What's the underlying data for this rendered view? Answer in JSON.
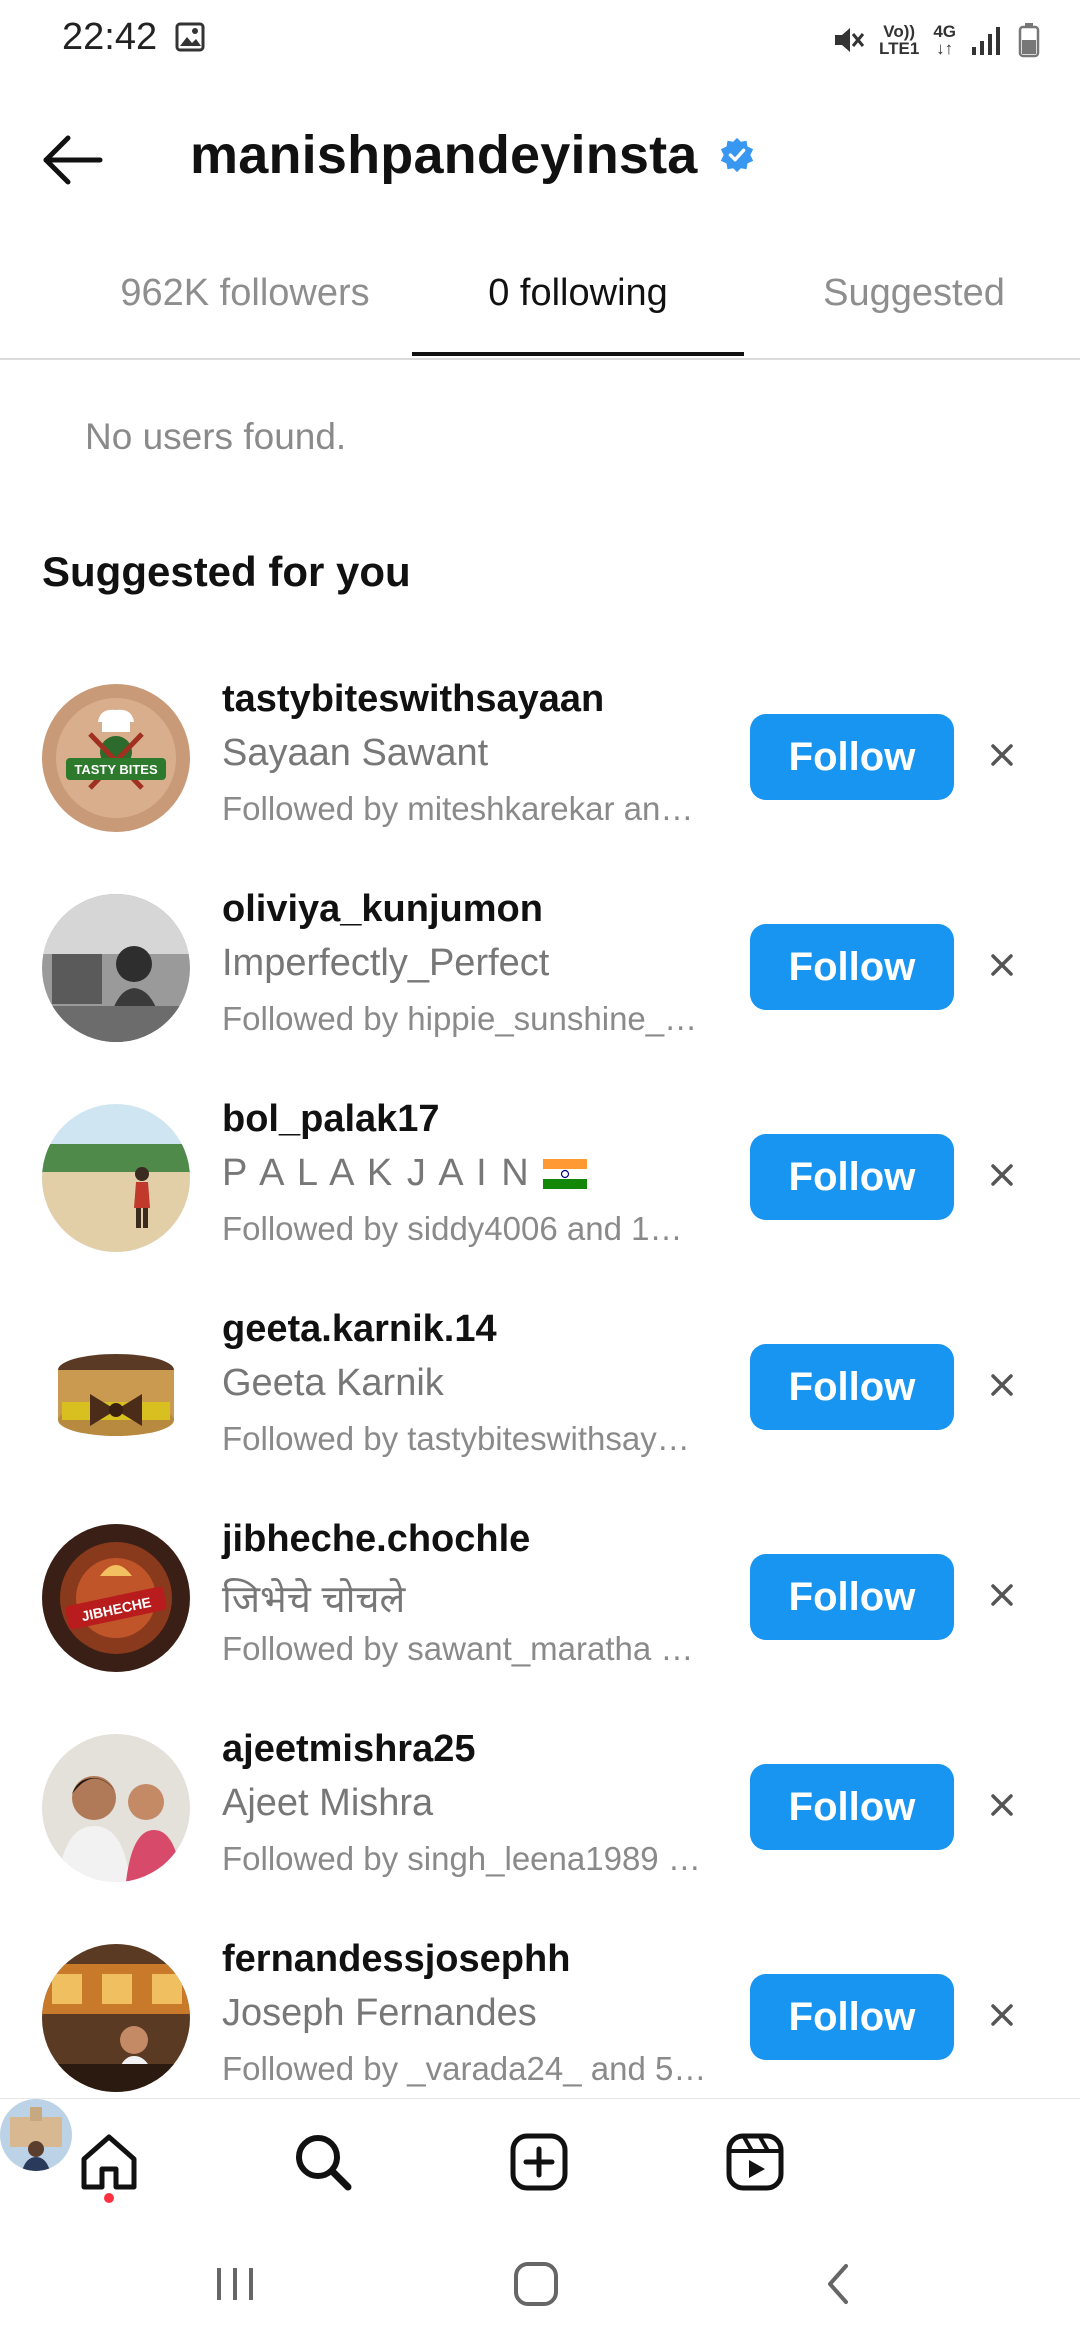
{
  "status_bar": {
    "time": "22:42",
    "icons": [
      "image-icon",
      "mute-icon",
      "volte-icon",
      "4g-icon",
      "signal-icon",
      "battery-icon"
    ],
    "volte_label_top": "Vo))",
    "volte_label_bottom": "LTE1",
    "network_label": "4G"
  },
  "header": {
    "back_icon": "arrow-left-icon",
    "title": "manishpandeyinsta",
    "verified_icon": "verified-badge-icon"
  },
  "tabs": [
    {
      "label": "962K followers",
      "active": false
    },
    {
      "label": "0 following",
      "active": true
    },
    {
      "label": "Suggested",
      "active": false
    }
  ],
  "empty_state": "No users found.",
  "section_title": "Suggested for you",
  "suggestions": [
    {
      "username": "tastybiteswithsayaan",
      "full_name": "Sayaan Sawant",
      "followed_by": "Followed by miteshkarekar an…",
      "button": "Follow",
      "avatar_logo_text": "TASTY BITES"
    },
    {
      "username": "oliviya_kunjumon",
      "full_name": "Imperfectly_Perfect",
      "followed_by": "Followed by hippie_sunshine_…",
      "button": "Follow"
    },
    {
      "username": "bol_palak17",
      "full_name": "P A L A K   J A I N",
      "followed_by": "Followed by siddy4006 and 1…",
      "button": "Follow"
    },
    {
      "username": "geeta.karnik.14",
      "full_name": "Geeta Karnik",
      "followed_by": "Followed by tastybiteswithsay…",
      "button": "Follow"
    },
    {
      "username": "jibheche.chochle",
      "full_name": "जिभेचे चोचले",
      "followed_by": "Followed by sawant_maratha …",
      "button": "Follow",
      "avatar_logo_text": "JIBHECHE"
    },
    {
      "username": "ajeetmishra25",
      "full_name": "Ajeet Mishra",
      "followed_by": "Followed by singh_leena1989 …",
      "button": "Follow"
    },
    {
      "username": "fernandessjosephh",
      "full_name": "Joseph Fernandes",
      "followed_by": "Followed by _varada24_ and 5…",
      "button": "Follow"
    }
  ],
  "bottom_nav": [
    "home-icon",
    "search-icon",
    "create-icon",
    "reels-icon",
    "profile-avatar"
  ],
  "system_nav": [
    "recents-icon",
    "home-button-icon",
    "back-icon"
  ],
  "colors": {
    "follow_button": "#1795f0",
    "verified": "#3897f0",
    "notification_dot": "#ff3040"
  }
}
